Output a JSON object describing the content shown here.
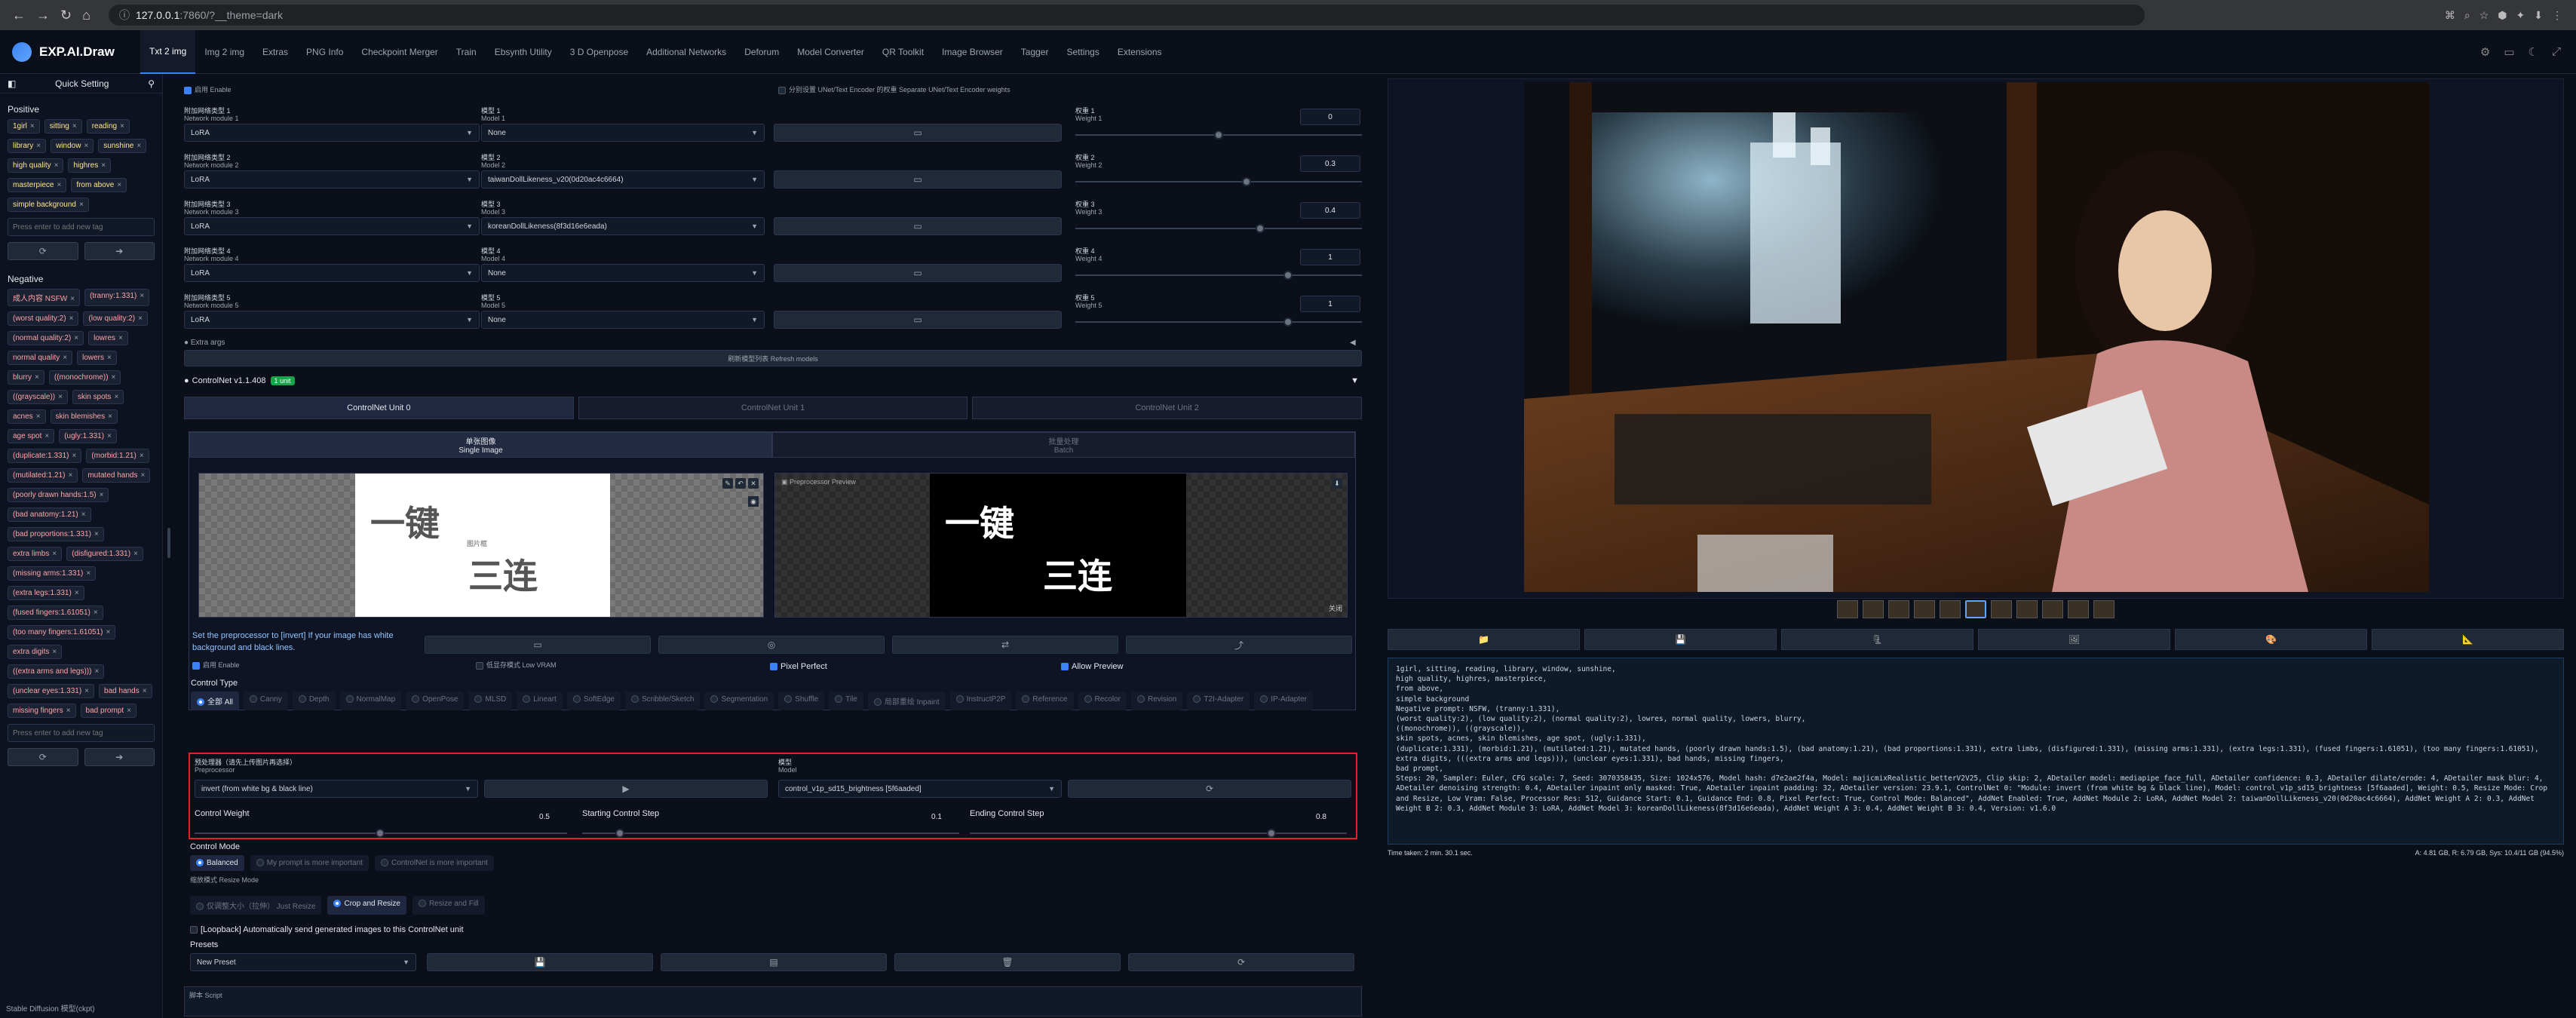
{
  "browser": {
    "url_host": "127.0.0.1",
    "url_rest": ":7860/?__theme=dark"
  },
  "app": {
    "name": "EXP.AI.Draw",
    "tabs": [
      "Txt 2 img",
      "Img 2 img",
      "Extras",
      "PNG Info",
      "Checkpoint Merger",
      "Train",
      "Ebsynth Utility",
      "3 D Openpose",
      "Additional Networks",
      "Deforum",
      "Model Converter",
      "QR Toolkit",
      "Image Browser",
      "Tagger",
      "Settings",
      "Extensions"
    ]
  },
  "sidebar": {
    "title": "Quick Setting",
    "positive_label": "Positive",
    "positive_tags": [
      "1girl",
      "sitting",
      "reading",
      "library",
      "window",
      "sunshine",
      "high quality",
      "highres",
      "masterpiece",
      "from above",
      "simple background"
    ],
    "input_placeholder": "Press enter to add new tag",
    "negative_label": "Negative",
    "negative_tags": [
      "成人内容 NSFW",
      "(tranny:1.331)",
      "(worst quality:2)",
      "(low quality:2)",
      "(normal quality:2)",
      "lowres",
      "normal quality",
      "lowers",
      "blurry",
      "((monochrome))",
      "((grayscale))",
      "skin spots",
      "acnes",
      "skin blemishes",
      "age spot",
      "(ugly:1.331)",
      "(duplicate:1.331)",
      "(morbid:1.21)",
      "(mutilated:1.21)",
      "mutated hands",
      "(poorly drawn hands:1.5)",
      "(bad anatomy:1.21)",
      "(bad proportions:1.331)",
      "extra limbs",
      "(disfigured:1.331)",
      "(missing arms:1.331)",
      "(extra legs:1.331)",
      "(fused fingers:1.61051)",
      "(too many fingers:1.61051)",
      "extra digits",
      "((extra arms and legs)))",
      "(unclear eyes:1.331)",
      "bad hands",
      "missing fingers",
      "bad prompt"
    ],
    "footer": "Stable Diffusion 模型(ckpt)"
  },
  "addnet": {
    "enable": "启用 Enable",
    "separate": "分别设置 UNet/Text Encoder 的权重 Separate UNet/Text Encoder weights",
    "modules": [
      {
        "label": "附加网络类型 1",
        "sub": "Network module 1",
        "type": "LoRA",
        "model_label": "模型 1",
        "model_sub": "Model 1",
        "model": "None",
        "w_label": "权重 1",
        "w_sub": "Weight 1",
        "weight": "0",
        "frac": 0.5
      },
      {
        "label": "附加网络类型 2",
        "sub": "Network module 2",
        "type": "LoRA",
        "model_label": "模型 2",
        "model_sub": "Model 2",
        "model": "taiwanDollLikeness_v20(0d20ac4c6664)",
        "w_label": "权重 2",
        "w_sub": "Weight 2",
        "weight": "0.3",
        "frac": 0.6
      },
      {
        "label": "附加网络类型 3",
        "sub": "Network module 3",
        "type": "LoRA",
        "model_label": "模型 3",
        "model_sub": "Model 3",
        "model": "koreanDollLikeness(8f3d16e6eada)",
        "w_label": "权重 3",
        "w_sub": "Weight 3",
        "weight": "0.4",
        "frac": 0.65
      },
      {
        "label": "附加网络类型 4",
        "sub": "Network module 4",
        "type": "LoRA",
        "model_label": "模型 4",
        "model_sub": "Model 4",
        "model": "None",
        "w_label": "权重 4",
        "w_sub": "Weight 4",
        "weight": "1",
        "frac": 0.75
      },
      {
        "label": "附加网络类型 5",
        "sub": "Network module 5",
        "type": "LoRA",
        "model_label": "模型 5",
        "model_sub": "Model 5",
        "model": "None",
        "w_label": "权重 5",
        "w_sub": "Weight 5",
        "weight": "1",
        "frac": 0.75
      }
    ],
    "extra_args": "Extra args",
    "refresh": "刷新模型列表 Refresh models"
  },
  "controlnet": {
    "title": "ControlNet v1.1.408",
    "badge": "1 unit",
    "units": [
      "ControlNet Unit 0",
      "ControlNet Unit 1",
      "ControlNet Unit 2"
    ],
    "img_tabs": [
      {
        "cn": "单张图像",
        "en": "Single Image"
      },
      {
        "cn": "批量处理",
        "en": "Batch"
      }
    ],
    "source_text_a": "一键",
    "source_text_b": "三连",
    "source_stamp": "图片框",
    "preview_label": "Preprocessor Preview",
    "preview_close": "关闭",
    "hint": "Set the preprocessor to [invert] If your image has white background and black lines.",
    "enable": "启用 Enable",
    "lowvram": "低显存模式 Low VRAM",
    "pixel_perfect": "Pixel Perfect",
    "allow_preview": "Allow Preview",
    "control_type_label": "Control Type",
    "control_types": [
      "全部 All",
      "Canny",
      "Depth",
      "NormalMap",
      "OpenPose",
      "MLSD",
      "Lineart",
      "SoftEdge",
      "Scribble/Sketch",
      "Segmentation",
      "Shuffle",
      "Tile",
      "局部重绘 Inpaint",
      "InstructP2P",
      "Reference",
      "Recolor",
      "Revision",
      "T2I-Adapter",
      "IP-Adapter"
    ],
    "preprocessor_label": "预处理器（请先上传图片再选择）",
    "preprocessor_sub": "Preprocessor",
    "preprocessor": "invert (from white bg & black line)",
    "model_label": "模型",
    "model_sub": "Model",
    "model": "control_v1p_sd15_brightness [5f6aaded]",
    "weight_label": "Control Weight",
    "weight": "0.5",
    "start_label": "Starting Control Step",
    "start": "0.1",
    "end_label": "Ending Control Step",
    "end": "0.8",
    "mode_label": "Control Mode",
    "modes": [
      "Balanced",
      "My prompt is more important",
      "ControlNet is more important"
    ],
    "resize_label": "缩放模式 Resize Mode",
    "resizes": [
      "仅调整大小（拉伸） Just Resize",
      "Crop and Resize",
      "Resize and Fill"
    ],
    "loopback": "[Loopback] Automatically send generated images to this ControlNet unit",
    "presets_label": "Presets",
    "preset": "New Preset",
    "script_label": "脚本 Script"
  },
  "output": {
    "info": "1girl, sitting, reading, library, window, sunshine,\nhigh quality, highres, masterpiece,\nfrom above,\nsimple background\nNegative prompt: NSFW, (tranny:1.331),\n(worst quality:2), (low quality:2), (normal quality:2), lowres, normal quality, lowers, blurry,\n((monochrome)), ((grayscale)),\nskin spots, acnes, skin blemishes, age spot, (ugly:1.331),\n(duplicate:1.331), (morbid:1.21), (mutilated:1.21), mutated hands, (poorly drawn hands:1.5), (bad anatomy:1.21), (bad proportions:1.331), extra limbs, (disfigured:1.331), (missing arms:1.331), (extra legs:1.331), (fused fingers:1.61051), (too many fingers:1.61051),\nextra digits, (((extra arms and legs))), (unclear eyes:1.331), bad hands, missing fingers,\nbad prompt,\nSteps: 20, Sampler: Euler, CFG scale: 7, Seed: 3070358435, Size: 1024x576, Model hash: d7e2ae2f4a, Model: majicmixRealistic_betterV2V25, Clip skip: 2, ADetailer model: mediapipe_face_full, ADetailer confidence: 0.3, ADetailer dilate/erode: 4, ADetailer mask blur: 4, ADetailer denoising strength: 0.4, ADetailer inpaint only masked: True, ADetailer inpaint padding: 32, ADetailer version: 23.9.1, ControlNet 0: \"Module: invert (from white bg & black line), Model: control_v1p_sd15_brightness [5f6aaded], Weight: 0.5, Resize Mode: Crop and Resize, Low Vram: False, Processor Res: 512, Guidance Start: 0.1, Guidance End: 0.8, Pixel Perfect: True, Control Mode: Balanced\", AddNet Enabled: True, AddNet Module 2: LoRA, AddNet Model 2: taiwanDollLikeness_v20(0d20ac4c6664), AddNet Weight A 2: 0.3, AddNet Weight B 2: 0.3, AddNet Module 3: LoRA, AddNet Model 3: koreanDollLikeness(8f3d16e6eada), AddNet Weight A 3: 0.4, AddNet Weight B 3: 0.4, Version: v1.6.0",
    "time": "Time taken: 2 min. 30.1 sec.",
    "vram": "A: 4.81 GB, R: 6.79 GB, Sys: 10.4/11 GB (94.5%)"
  }
}
